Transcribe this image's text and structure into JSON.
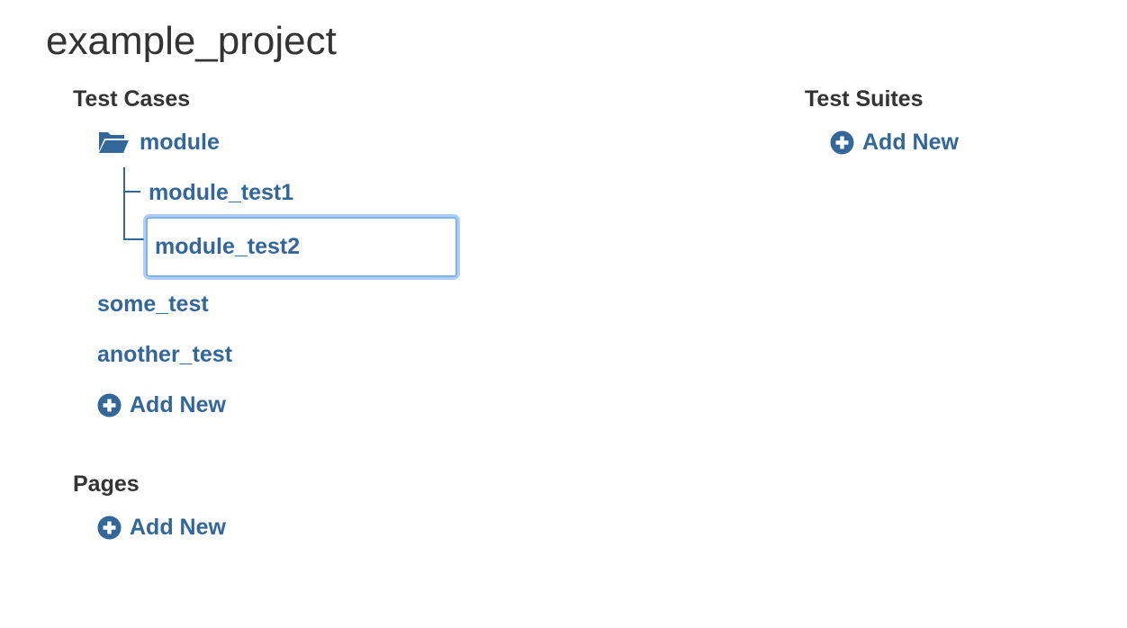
{
  "project": {
    "title": "example_project"
  },
  "test_cases": {
    "heading": "Test Cases",
    "folder": {
      "name": "module",
      "icon": "folder-open-icon",
      "children": [
        {
          "name": "module_test1"
        },
        {
          "name": "module_test2",
          "editing": true
        }
      ]
    },
    "items": [
      {
        "name": "some_test"
      },
      {
        "name": "another_test"
      }
    ],
    "add_new_label": "Add New"
  },
  "pages": {
    "heading": "Pages",
    "add_new_label": "Add New"
  },
  "test_suites": {
    "heading": "Test Suites",
    "add_new_label": "Add New"
  },
  "icons": {
    "add": "plus-circle-icon",
    "folder": "folder-open-icon"
  },
  "colors": {
    "link": "#336699",
    "text": "#333333",
    "focus": "#7fb3ee"
  }
}
